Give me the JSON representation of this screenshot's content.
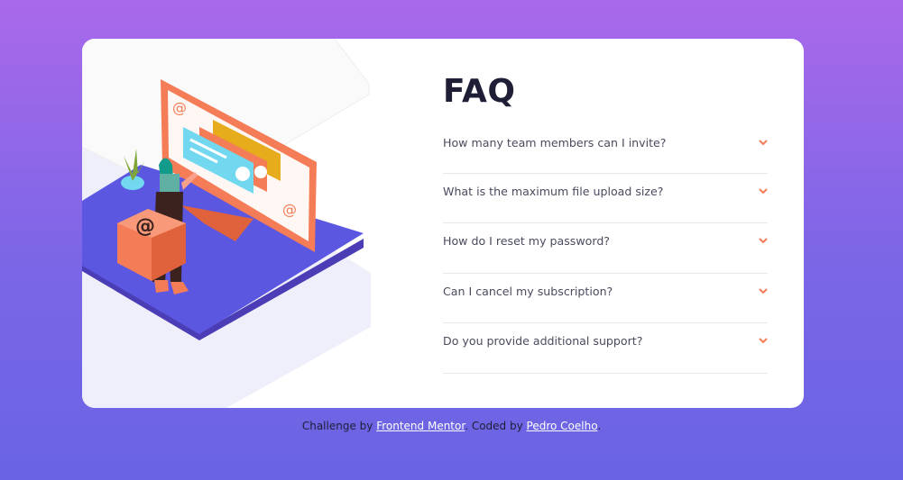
{
  "faq": {
    "title": "FAQ",
    "questions": [
      "How many team members can I invite?",
      "What is the maximum file upload size?",
      "How do I reset my password?",
      "Can I cancel my subscription?",
      "Do you provide additional support?"
    ]
  },
  "footer": {
    "prefix": "Challenge by ",
    "link1": "Frontend Mentor",
    "middle": ". Coded by ",
    "link2": "Pedro Coelho",
    "suffix": "."
  },
  "colors": {
    "accent": "#f47c57",
    "heading": "#1e1f36",
    "text": "#4a4b5e",
    "divider": "#e8e8ea",
    "background_top": "#a969ea",
    "background_bottom": "#6964e4",
    "illustration_purple": "#5b57e0"
  },
  "icons": {
    "question_chevron": "chevron-down-icon",
    "cube": "at-sign-box-icon"
  }
}
